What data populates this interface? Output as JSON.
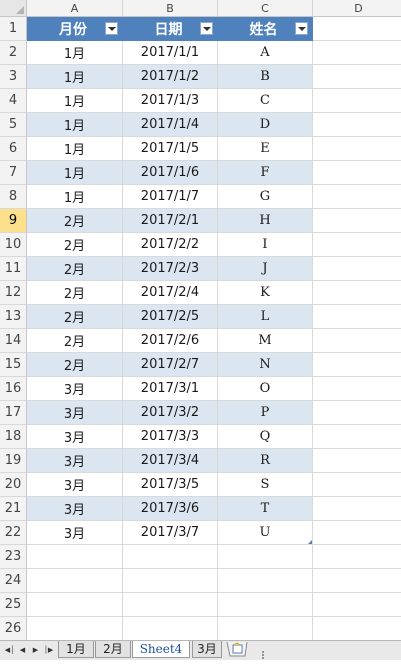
{
  "columns": [
    "A",
    "B",
    "C",
    "D"
  ],
  "headers": [
    "月份",
    "日期",
    "姓名"
  ],
  "rows": [
    [
      "1月",
      "2017/1/1",
      "A"
    ],
    [
      "1月",
      "2017/1/2",
      "B"
    ],
    [
      "1月",
      "2017/1/3",
      "C"
    ],
    [
      "1月",
      "2017/1/4",
      "D"
    ],
    [
      "1月",
      "2017/1/5",
      "E"
    ],
    [
      "1月",
      "2017/1/6",
      "F"
    ],
    [
      "1月",
      "2017/1/7",
      "G"
    ],
    [
      "2月",
      "2017/2/1",
      "H"
    ],
    [
      "2月",
      "2017/2/2",
      "I"
    ],
    [
      "2月",
      "2017/2/3",
      "J"
    ],
    [
      "2月",
      "2017/2/4",
      "K"
    ],
    [
      "2月",
      "2017/2/5",
      "L"
    ],
    [
      "2月",
      "2017/2/6",
      "M"
    ],
    [
      "2月",
      "2017/2/7",
      "N"
    ],
    [
      "3月",
      "2017/3/1",
      "O"
    ],
    [
      "3月",
      "2017/3/2",
      "P"
    ],
    [
      "3月",
      "2017/3/3",
      "Q"
    ],
    [
      "3月",
      "2017/3/4",
      "R"
    ],
    [
      "3月",
      "2017/3/5",
      "S"
    ],
    [
      "3月",
      "2017/3/6",
      "T"
    ],
    [
      "3月",
      "2017/3/7",
      "U"
    ]
  ],
  "row_numbers": [
    "1",
    "2",
    "3",
    "4",
    "5",
    "6",
    "7",
    "8",
    "9",
    "10",
    "11",
    "12",
    "13",
    "14",
    "15",
    "16",
    "17",
    "18",
    "19",
    "20",
    "21",
    "22",
    "23",
    "24",
    "25",
    "26"
  ],
  "selected_row": "9",
  "tabs": [
    "1月",
    "2月",
    "Sheet4",
    "3月"
  ],
  "active_tab": "Sheet4",
  "colors": {
    "header_fill": "#4f81bd",
    "band_fill": "#dce6f1",
    "selected_row_header": "#fde08b"
  }
}
